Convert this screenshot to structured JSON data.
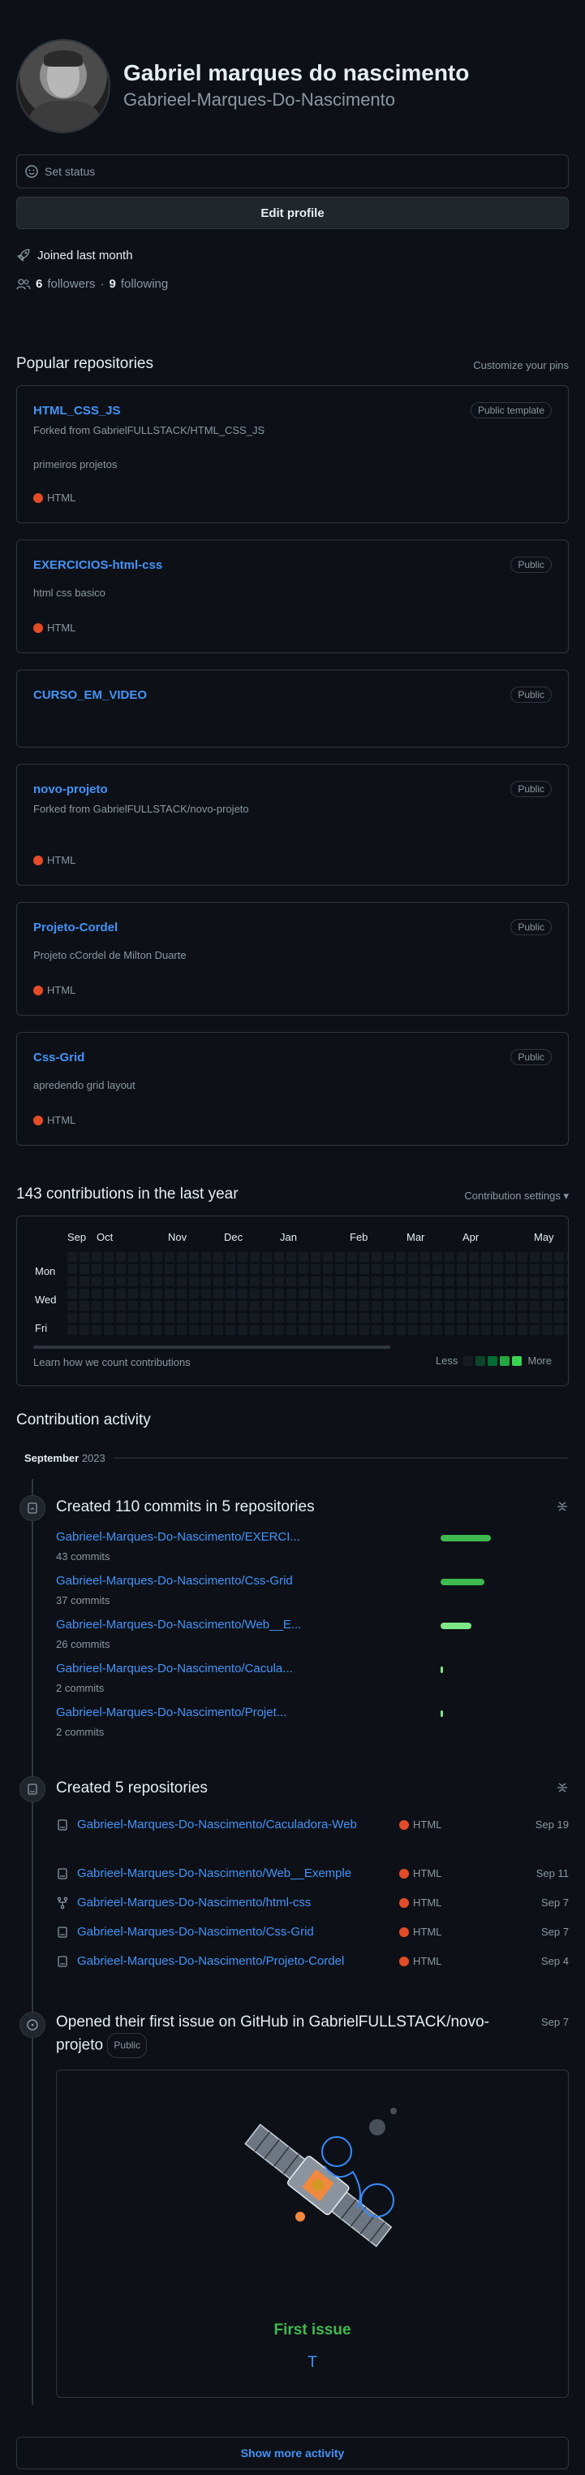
{
  "profile": {
    "name": "Gabriel marques do nascimento",
    "login": "Gabrieel-Marques-Do-Nascimento",
    "status_placeholder": "Set status",
    "edit_label": "Edit profile",
    "joined": "Joined last month",
    "followers_count": "6",
    "followers_label": "followers",
    "separator": "·",
    "following_count": "9",
    "following_label": "following"
  },
  "popular": {
    "title": "Popular repositories",
    "customize": "Customize your pins",
    "repos": [
      {
        "name": "HTML_CSS_JS",
        "badge": "Public template",
        "fork": "Forked from GabrielFULLSTACK/HTML_CSS_JS",
        "desc": "primeiros projetos",
        "lang": "HTML"
      },
      {
        "name": "EXERCICIOS-html-css",
        "badge": "Public",
        "fork": "",
        "desc": "html css basico",
        "lang": "HTML"
      },
      {
        "name": "CURSO_EM_VIDEO",
        "badge": "Public",
        "fork": "",
        "desc": "",
        "lang": ""
      },
      {
        "name": "novo-projeto",
        "badge": "Public",
        "fork": "Forked from GabrielFULLSTACK/novo-projeto",
        "desc": "",
        "lang": "HTML"
      },
      {
        "name": "Projeto-Cordel",
        "badge": "Public",
        "fork": "",
        "desc": "Projeto cCordel de Milton Duarte",
        "lang": "HTML"
      },
      {
        "name": "Css-Grid",
        "badge": "Public",
        "fork": "",
        "desc": "apredendo grid layout",
        "lang": "HTML"
      }
    ]
  },
  "contributions": {
    "title": "143 contributions in the last year",
    "settings": "Contribution settings ▾",
    "months": [
      "Sep",
      "Oct",
      "Nov",
      "Dec",
      "Jan",
      "Feb",
      "Mar",
      "Apr",
      "May"
    ],
    "days": [
      "Mon",
      "Wed",
      "Fri"
    ],
    "learn": "Learn how we count contributions",
    "less": "Less",
    "more": "More",
    "colors": [
      "#161b22",
      "#0e4429",
      "#006d32",
      "#26a641",
      "#39d353"
    ]
  },
  "activity": {
    "title": "Contribution activity",
    "month": "September",
    "year": "2023",
    "commits": {
      "title": "Created 110 commits in 5 repositories",
      "rows": [
        {
          "repo": "Gabrieel-Marques-Do-Nascimento/EXERCI...",
          "count": "43 commits",
          "share": 0.39,
          "color": "#3fb950"
        },
        {
          "repo": "Gabrieel-Marques-Do-Nascimento/Css-Grid",
          "count": "37 commits",
          "share": 0.34,
          "color": "#3fb950"
        },
        {
          "repo": "Gabrieel-Marques-Do-Nascimento/Web__E...",
          "count": "26 commits",
          "share": 0.24,
          "color": "#7ee787"
        },
        {
          "repo": "Gabrieel-Marques-Do-Nascimento/Cacula...",
          "count": "2 commits",
          "share": 0.02,
          "color": "#7ee787"
        },
        {
          "repo": "Gabrieel-Marques-Do-Nascimento/Projet...",
          "count": "2 commits",
          "share": 0.02,
          "color": "#7ee787"
        }
      ]
    },
    "repos_created": {
      "title": "Created 5 repositories",
      "rows": [
        {
          "repo": "Gabrieel-Marques-Do-Nascimento/Caculadora-Web",
          "lang": "HTML",
          "date": "Sep 19",
          "icon": "repo-icon"
        },
        {
          "repo": "Gabrieel-Marques-Do-Nascimento/Web__Exemple",
          "lang": "HTML",
          "date": "Sep 11",
          "icon": "repo-icon"
        },
        {
          "repo": "Gabrieel-Marques-Do-Nascimento/html-css",
          "lang": "HTML",
          "date": "Sep 7",
          "icon": "fork-icon"
        },
        {
          "repo": "Gabrieel-Marques-Do-Nascimento/Css-Grid",
          "lang": "HTML",
          "date": "Sep 7",
          "icon": "repo-icon"
        },
        {
          "repo": "Gabrieel-Marques-Do-Nascimento/Projeto-Cordel",
          "lang": "HTML",
          "date": "Sep 4",
          "icon": "repo-icon"
        }
      ]
    },
    "issue": {
      "title": "Opened their first issue on GitHub in GabrielFULLSTACK/novo-projeto",
      "badge": "Public",
      "date": "Sep 7",
      "label": "First issue",
      "issue_title": "T"
    },
    "show_more": "Show more activity"
  }
}
